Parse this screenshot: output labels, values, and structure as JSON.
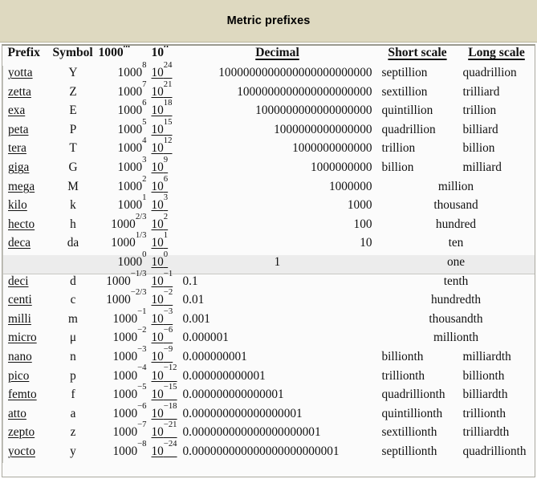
{
  "title": "Metric prefixes",
  "table": {
    "headers": {
      "prefix": "Prefix",
      "symbol": "Symbol",
      "thousand_power": "1000",
      "thousand_exp": "m",
      "ten_power": "10",
      "ten_exp": "n",
      "decimal": "Decimal",
      "short_scale": "Short scale",
      "long_scale": "Long scale"
    },
    "rows": [
      {
        "prefix": "yotta",
        "symbol": "Y",
        "thousand_exp": "8",
        "ten_exp": "24",
        "decimal": "1000000000000000000000000",
        "dec_align": "right",
        "short": "septillion",
        "long": "quadrillion",
        "merged": false,
        "highlight": false
      },
      {
        "prefix": "zetta",
        "symbol": "Z",
        "thousand_exp": "7",
        "ten_exp": "21",
        "decimal": "1000000000000000000000",
        "dec_align": "right",
        "short": "sextillion",
        "long": "trilliard",
        "merged": false,
        "highlight": false
      },
      {
        "prefix": "exa",
        "symbol": "E",
        "thousand_exp": "6",
        "ten_exp": "18",
        "decimal": "1000000000000000000",
        "dec_align": "right",
        "short": "quintillion",
        "long": "trillion",
        "merged": false,
        "highlight": false
      },
      {
        "prefix": "peta",
        "symbol": "P",
        "thousand_exp": "5",
        "ten_exp": "15",
        "decimal": "1000000000000000",
        "dec_align": "right",
        "short": "quadrillion",
        "long": "billiard",
        "merged": false,
        "highlight": false
      },
      {
        "prefix": "tera",
        "symbol": "T",
        "thousand_exp": "4",
        "ten_exp": "12",
        "decimal": "1000000000000",
        "dec_align": "right",
        "short": "trillion",
        "long": "billion",
        "merged": false,
        "highlight": false
      },
      {
        "prefix": "giga",
        "symbol": "G",
        "thousand_exp": "3",
        "ten_exp": "9",
        "decimal": "1000000000",
        "dec_align": "right",
        "short": "billion",
        "long": "milliard",
        "merged": false,
        "highlight": false
      },
      {
        "prefix": "mega",
        "symbol": "M",
        "thousand_exp": "2",
        "ten_exp": "6",
        "decimal": "1000000",
        "dec_align": "right",
        "merged_text": "million",
        "merged": true,
        "highlight": false
      },
      {
        "prefix": "kilo",
        "symbol": "k",
        "thousand_exp": "1",
        "ten_exp": "3",
        "decimal": "1000",
        "dec_align": "right",
        "merged_text": "thousand",
        "merged": true,
        "highlight": false
      },
      {
        "prefix": "hecto",
        "symbol": "h",
        "thousand_exp": "2/3",
        "ten_exp": "2",
        "decimal": "100",
        "dec_align": "right",
        "merged_text": "hundred",
        "merged": true,
        "highlight": false
      },
      {
        "prefix": "deca",
        "symbol": "da",
        "thousand_exp": "1/3",
        "ten_exp": "1",
        "decimal": "10",
        "dec_align": "right",
        "merged_text": "ten",
        "merged": true,
        "highlight": false
      },
      {
        "prefix": "",
        "symbol": "",
        "thousand_exp": "0",
        "ten_exp": "0",
        "decimal": "1",
        "dec_align": "center",
        "merged_text": "one",
        "merged": true,
        "highlight": true
      },
      {
        "prefix": "deci",
        "symbol": "d",
        "thousand_exp": "−1/3",
        "ten_exp": "−1",
        "decimal": "0.1",
        "dec_align": "left",
        "merged_text": "tenth",
        "merged": true,
        "highlight": false
      },
      {
        "prefix": "centi",
        "symbol": "c",
        "thousand_exp": "−2/3",
        "ten_exp": "−2",
        "decimal": "0.01",
        "dec_align": "left",
        "merged_text": "hundredth",
        "merged": true,
        "highlight": false
      },
      {
        "prefix": "milli",
        "symbol": "m",
        "thousand_exp": "−1",
        "ten_exp": "−3",
        "decimal": "0.001",
        "dec_align": "left",
        "merged_text": "thousandth",
        "merged": true,
        "highlight": false
      },
      {
        "prefix": "micro",
        "symbol": "μ",
        "thousand_exp": "−2",
        "ten_exp": "−6",
        "decimal": "0.000001",
        "dec_align": "left",
        "merged_text": "millionth",
        "merged": true,
        "highlight": false
      },
      {
        "prefix": "nano",
        "symbol": "n",
        "thousand_exp": "−3",
        "ten_exp": "−9",
        "decimal": "0.000000001",
        "dec_align": "left",
        "short": "billionth",
        "long": "milliardth",
        "merged": false,
        "highlight": false
      },
      {
        "prefix": "pico",
        "symbol": "p",
        "thousand_exp": "−4",
        "ten_exp": "−12",
        "decimal": "0.000000000001",
        "dec_align": "left",
        "short": "trillionth",
        "long": "billionth",
        "merged": false,
        "highlight": false
      },
      {
        "prefix": "femto",
        "symbol": "f",
        "thousand_exp": "−5",
        "ten_exp": "−15",
        "decimal": "0.000000000000001",
        "dec_align": "left",
        "short": "quadrillionth",
        "long": "billiardth",
        "merged": false,
        "highlight": false
      },
      {
        "prefix": "atto",
        "symbol": "a",
        "thousand_exp": "−6",
        "ten_exp": "−18",
        "decimal": "0.000000000000000001",
        "dec_align": "left",
        "short": "quintillionth",
        "long": "trillionth",
        "merged": false,
        "highlight": false
      },
      {
        "prefix": "zepto",
        "symbol": "z",
        "thousand_exp": "−7",
        "ten_exp": "−21",
        "decimal": "0.000000000000000000001",
        "dec_align": "left",
        "short": "sextillionth",
        "long": "trilliardth",
        "merged": false,
        "highlight": false
      },
      {
        "prefix": "yocto",
        "symbol": "y",
        "thousand_exp": "−8",
        "ten_exp": "−24",
        "decimal": "0.000000000000000000000001",
        "dec_align": "left",
        "short": "septillionth",
        "long": "quadrillionth",
        "merged": false,
        "highlight": false
      }
    ]
  },
  "colors": {
    "title_background": "#ded9c0",
    "highlight_row": "#ececec",
    "table_background": "#fbfbfb",
    "border": "#aaa9a0",
    "text": "#111111"
  }
}
